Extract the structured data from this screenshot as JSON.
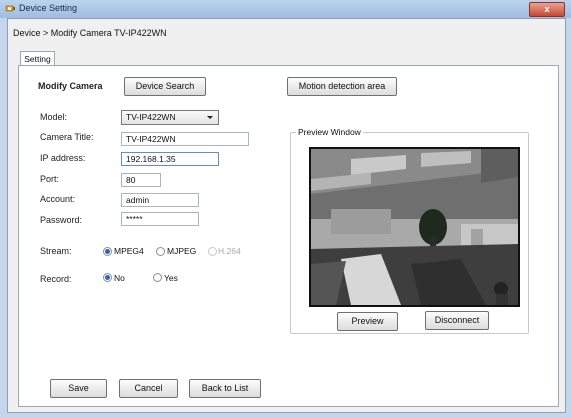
{
  "window": {
    "title": "Device Setting",
    "close_label": "x"
  },
  "breadcrumb": "Device > Modify Camera TV-IP422WN",
  "tabs": [
    {
      "label": "Setting"
    }
  ],
  "form": {
    "section_title": "Modify Camera",
    "device_search_label": "Device Search",
    "motion_area_label": "Motion detection area",
    "model": {
      "label": "Model:",
      "value": "TV-IP422WN"
    },
    "camera_title": {
      "label": "Camera Title:",
      "value": "TV-IP422WN"
    },
    "ip_address": {
      "label": "IP address:",
      "value": "192.168.1.35"
    },
    "port": {
      "label": "Port:",
      "value": "80"
    },
    "account": {
      "label": "Account:",
      "value": "admin"
    },
    "password": {
      "label": "Password:",
      "value": "*****"
    },
    "stream": {
      "label": "Stream:",
      "options": [
        {
          "label": "MPEG4",
          "selected": true,
          "enabled": true
        },
        {
          "label": "MJPEG",
          "selected": false,
          "enabled": true
        },
        {
          "label": "H.264",
          "selected": false,
          "enabled": false
        }
      ]
    },
    "record": {
      "label": "Record:",
      "options": [
        {
          "label": "No",
          "selected": true
        },
        {
          "label": "Yes",
          "selected": false
        }
      ]
    }
  },
  "preview_window": {
    "title": "Preview Window",
    "preview_label": "Preview",
    "disconnect_label": "Disconnect"
  },
  "footer": {
    "save_label": "Save",
    "cancel_label": "Cancel",
    "back_label": "Back to List"
  },
  "colors": {
    "accent": "#2a64b8",
    "titlebar": "#9fbde2",
    "close": "#c6482f"
  }
}
